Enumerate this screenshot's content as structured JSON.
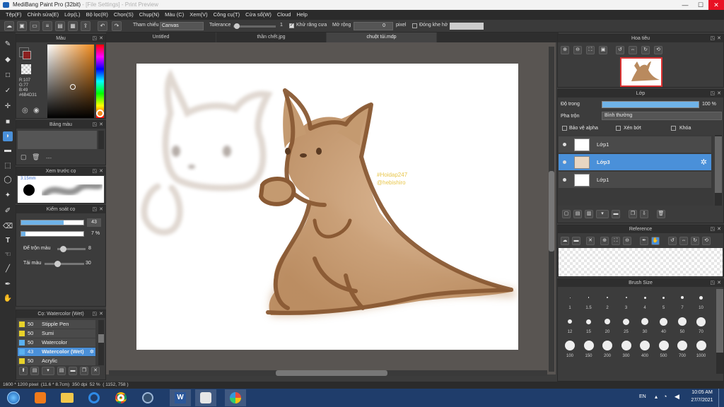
{
  "window": {
    "title": "MediBang Paint Pro (32bit)",
    "title_faint": "- [File Settings] - Print Preview"
  },
  "menu": [
    "Tệp(F)",
    "Chỉnh sửa(E)",
    "Lớp(L)",
    "Bộ lọc(R)",
    "Chọn(S)",
    "Chụp(N)",
    "Màu (C)",
    "Xem(V)",
    "Công cụ(T)",
    "Cửa sổ(W)",
    "Cloud",
    "Help"
  ],
  "toolbar": {
    "reference_label": "Tham chiếu",
    "reference_value": "Canvas",
    "tolerance_label": "Tolerance",
    "tolerance_value": "1",
    "antialias_label": "Khử răng cưa",
    "expand_label": "Mở rộng",
    "expand_value": "0",
    "expand_unit": "pixel",
    "close_gap_label": "Đóng khe hở",
    "tolerance_level": 0.02
  },
  "color_panel": {
    "title": "Màu",
    "r": "R:107",
    "g": "G:77",
    "b": "B:49",
    "hex": "#6B4D31",
    "fg": "#b5302a",
    "picked": "#6B4D31"
  },
  "palette_panel": {
    "title": "Bảng màu",
    "dots": "---"
  },
  "brush_preview": {
    "title": "Xem trước cọ",
    "size": "3.15mm"
  },
  "brush_control": {
    "title": "Kiểm soát cọ",
    "size_value": "43",
    "opacity_value": "7 %",
    "blend_label": "Để trộn màu",
    "blend_value": "8",
    "reload_label": "Tải màu",
    "reload_value": "30"
  },
  "brush_list": {
    "title": "Cọ: Watercolor (Wet)",
    "items": [
      {
        "size": "50",
        "name": "Stipple Pen"
      },
      {
        "size": "50",
        "name": "Sumi"
      },
      {
        "size": "50",
        "name": "Watercolor"
      },
      {
        "size": "43",
        "name": "Watercolor (Wet)"
      },
      {
        "size": "50",
        "name": "Acrylic"
      }
    ]
  },
  "tabs": [
    "Untitled",
    "thần chết.jpg",
    "chuột túi.mdp"
  ],
  "watermark": {
    "line1": "#Hoidap247",
    "line2": "@hebishiro"
  },
  "navigator": {
    "title": "Hoa tiêu"
  },
  "layer_panel": {
    "title": "Lớp",
    "opacity_label": "Độ trong",
    "opacity_value": "100 %",
    "opacity_level": 1.0,
    "blend_label": "Pha trộn",
    "blend_value": "Bình thường",
    "protect_alpha": "Bảo vệ alpha",
    "clip": "Xén bớt",
    "lock": "Khóa",
    "layers": [
      {
        "name": "Lớp1"
      },
      {
        "name": "Lớp3"
      },
      {
        "name": "Lớp1"
      }
    ]
  },
  "reference_panel": {
    "title": "Reference"
  },
  "brush_size_panel": {
    "title": "Brush Size",
    "sizes": [
      "1",
      "1.5",
      "2",
      "3",
      "4",
      "5",
      "7",
      "10",
      "12",
      "15",
      "20",
      "25",
      "30",
      "40",
      "50",
      "70",
      "100",
      "150",
      "200",
      "300",
      "400",
      "500",
      "700",
      "1000"
    ]
  },
  "status": {
    "dims": "1600 * 1200 pixel",
    "cm": "(11.6 * 8.7cm)",
    "dpi": "350 dpi",
    "zoom": "52 %",
    "coords": "( 1152, 758 )"
  },
  "taskbar": {
    "lang": "EN",
    "time": "10:05 AM",
    "date": "27/7/2021"
  },
  "colors": {
    "accent": "#4a90d9",
    "kangaroo_fill": "#c9a27b",
    "kangaroo_outline": "#8a5a34",
    "watermark": "#e8c64a"
  }
}
